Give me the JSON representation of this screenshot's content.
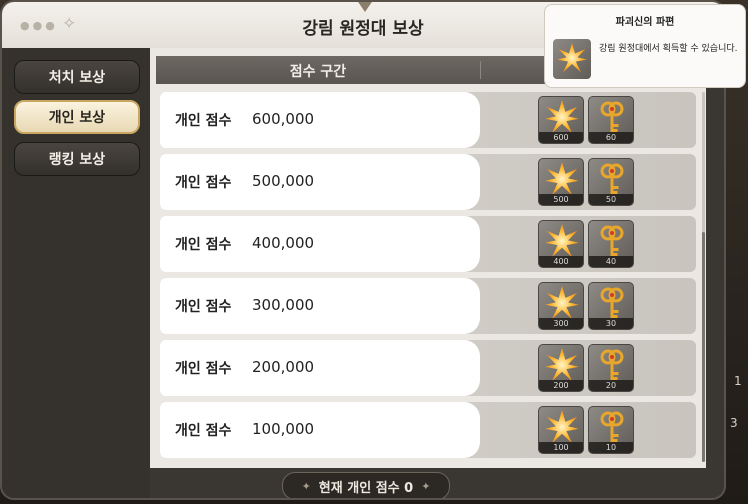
{
  "window": {
    "title": "강림 원정대 보상"
  },
  "sidebar": {
    "items": [
      {
        "label": "처치 보상",
        "active": false
      },
      {
        "label": "개인 보상",
        "active": true
      },
      {
        "label": "랭킹 보상",
        "active": false
      }
    ]
  },
  "table": {
    "header": "점수 구간",
    "rows": [
      {
        "label": "개인 점수",
        "score": "600,000",
        "rewards": [
          {
            "icon": "destruction-fragment-icon",
            "count": "600"
          },
          {
            "icon": "key-icon",
            "count": "60"
          }
        ]
      },
      {
        "label": "개인 점수",
        "score": "500,000",
        "rewards": [
          {
            "icon": "destruction-fragment-icon",
            "count": "500"
          },
          {
            "icon": "key-icon",
            "count": "50"
          }
        ]
      },
      {
        "label": "개인 점수",
        "score": "400,000",
        "rewards": [
          {
            "icon": "destruction-fragment-icon",
            "count": "400"
          },
          {
            "icon": "key-icon",
            "count": "40"
          }
        ]
      },
      {
        "label": "개인 점수",
        "score": "300,000",
        "rewards": [
          {
            "icon": "destruction-fragment-icon",
            "count": "300"
          },
          {
            "icon": "key-icon",
            "count": "30"
          }
        ]
      },
      {
        "label": "개인 점수",
        "score": "200,000",
        "rewards": [
          {
            "icon": "destruction-fragment-icon",
            "count": "200"
          },
          {
            "icon": "key-icon",
            "count": "20"
          }
        ]
      },
      {
        "label": "개인 점수",
        "score": "100,000",
        "rewards": [
          {
            "icon": "destruction-fragment-icon",
            "count": "100"
          },
          {
            "icon": "key-icon",
            "count": "10"
          }
        ]
      }
    ]
  },
  "footer": {
    "current_score": "현재 개인 점수 0"
  },
  "tooltip": {
    "title": "파괴신의 파편",
    "description": "강림 원정대에서 획득할 수 있습니다."
  },
  "background": {
    "edge_text_1": "1",
    "edge_text_2": "3"
  },
  "colors": {
    "accent_gold": "#c9a761",
    "panel_bg": "#ebe8e3",
    "header_bg": "#5f5a55"
  }
}
